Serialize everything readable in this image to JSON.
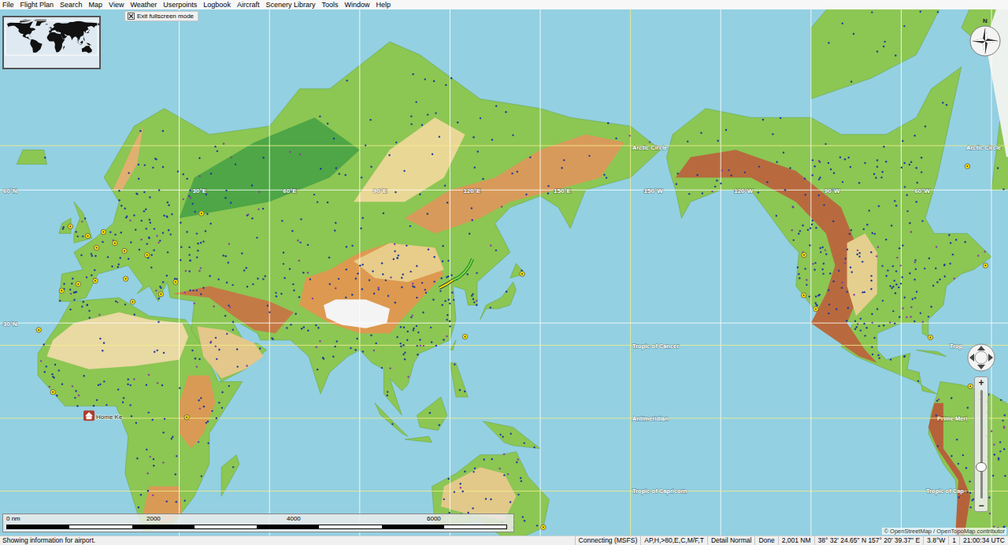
{
  "menu": [
    {
      "label": "File"
    },
    {
      "label": "Flight Plan"
    },
    {
      "label": "Search"
    },
    {
      "label": "Map"
    },
    {
      "label": "View"
    },
    {
      "label": "Weather"
    },
    {
      "label": "Userpoints"
    },
    {
      "label": "Logbook"
    },
    {
      "label": "Aircraft"
    },
    {
      "label": "Scenery Library"
    },
    {
      "label": "Tools"
    },
    {
      "label": "Window"
    },
    {
      "label": "Help"
    }
  ],
  "fullscreen_button": {
    "label": "Exit fullscreen mode"
  },
  "map": {
    "grid_labels": [
      "60°N",
      "30°E",
      "60°E",
      "90°E",
      "120°E",
      "150°E",
      "150°W",
      "120°W",
      "90°W",
      "60°W",
      "30°N"
    ],
    "line_labels": [
      "Arctic Circle",
      "Tropic of Cancer",
      "Antimeridian",
      "Tropic of Capricorn",
      "Arctic Circle",
      "Trop",
      "Prime Meri",
      "Tropic of Cap"
    ],
    "home_label": "Home Ke",
    "compass": {
      "label": "N"
    },
    "zoom": {
      "plus": "+",
      "minus": "−",
      "level": 0.28
    },
    "scale_bar": {
      "labels": [
        "0 nm",
        "2000",
        "4000",
        "6000"
      ]
    },
    "attribution": "© OpenStreetMap / OpenTopoMap contributor"
  },
  "status_bar": {
    "message": "Showing information for airport.",
    "fields": [
      "Connecting (MSFS)",
      "AP,H,>80,E,C,M/F,T",
      "Detail Normal",
      "Done",
      "2,001 NM",
      "38° 32' 24.65\" N 157° 20' 39.37\" E",
      "3.8°W",
      "1",
      "21:00:34 UTC"
    ]
  }
}
